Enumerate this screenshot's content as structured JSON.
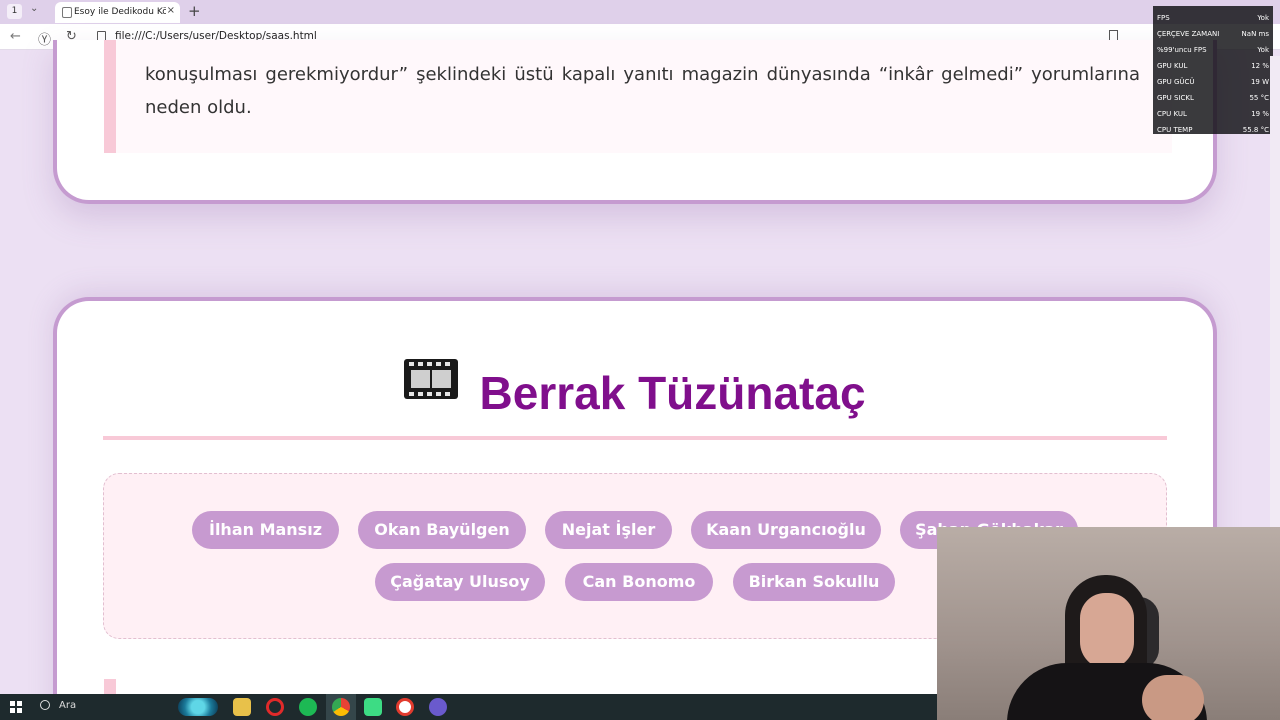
{
  "browser": {
    "tab_number": "1",
    "tab_title": "Esoy ile Dedikodu Köşesi",
    "url": "file:///C:/Users/user/Desktop/saas.html",
    "new_tab_symbol": "+",
    "close_symbol": "×"
  },
  "article": {
    "quote_text": "konuşulması gerekmiyordur” şeklindeki üstü kapalı yanıtı magazin dünyasında “inkâr gelmedi” yorumlarına neden oldu."
  },
  "profile": {
    "name": "Berrak Tüzünataç",
    "icon": "film-frames-icon",
    "tags": [
      "İlhan Mansız",
      "Okan Bayülgen",
      "Nejat İşler",
      "Kaan Urgancıoğlu",
      "Şahan Gökbakar",
      "Çağatay Ulusoy",
      "Can Bonomo",
      "Birkan Sokullu"
    ]
  },
  "perf_overlay": {
    "rows": [
      {
        "label": "FPS",
        "value": "Yok"
      },
      {
        "label": "ÇERÇEVE ZAMANI",
        "value": "NaN ms"
      },
      {
        "label": "%99'uncu FPS",
        "value": "Yok"
      },
      {
        "label": "GPU KUL",
        "value": "12 %"
      },
      {
        "label": "GPU GÜCÜ",
        "value": "19 W"
      },
      {
        "label": "GPU SICKL",
        "value": "55 °C"
      },
      {
        "label": "CPU KUL",
        "value": "19 %"
      },
      {
        "label": "CPU TEMP",
        "value": "55.8 °C"
      }
    ]
  },
  "taskbar": {
    "search_label": "Ara"
  },
  "colors": {
    "page_background": "#ece0f3",
    "card_border": "#c59bd0",
    "heading": "#800f8c",
    "tag_background": "#c79ad0",
    "accent_pink": "#f8c9d7"
  }
}
